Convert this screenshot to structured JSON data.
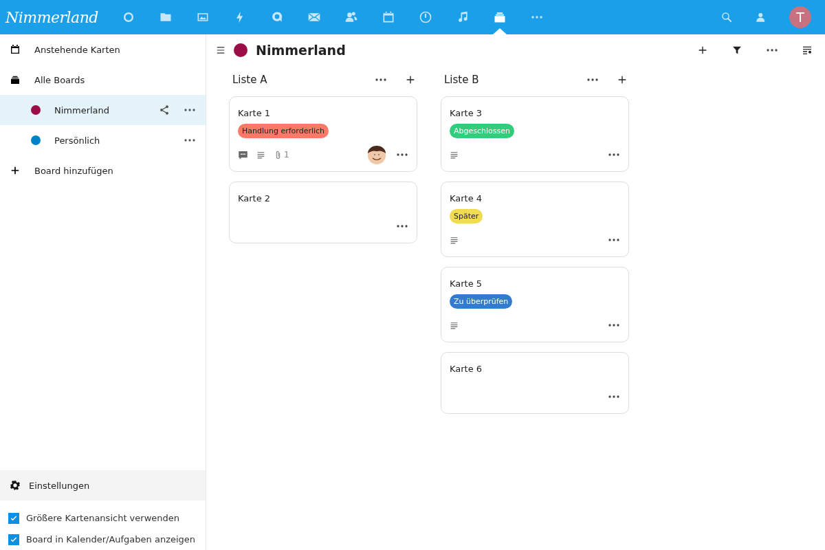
{
  "header": {
    "logo": "Nimmerland",
    "apps": [
      {
        "kind": "dashboard",
        "selected": false
      },
      {
        "kind": "files",
        "selected": false
      },
      {
        "kind": "photos",
        "selected": false
      },
      {
        "kind": "activity",
        "selected": false
      },
      {
        "kind": "talk",
        "selected": false
      },
      {
        "kind": "mail",
        "selected": false
      },
      {
        "kind": "contacts",
        "selected": false
      },
      {
        "kind": "calendar",
        "selected": false
      },
      {
        "kind": "tasks",
        "selected": false
      },
      {
        "kind": "music",
        "selected": false
      },
      {
        "kind": "deck",
        "selected": true
      },
      {
        "kind": "more",
        "selected": false
      }
    ],
    "avatar": "T"
  },
  "sidebar": {
    "nav": [
      {
        "kind": "upcoming",
        "label": "Anstehende Karten"
      },
      {
        "kind": "boards",
        "label": "Alle Boards"
      }
    ],
    "boards": [
      {
        "name": "Nimmerland",
        "color": "#9b0d47",
        "selected": true,
        "shared": true
      },
      {
        "name": "Persönlich",
        "color": "#0082c9",
        "selected": false,
        "shared": false
      }
    ],
    "add_board": "Board hinzufügen",
    "settings": "Einstellungen",
    "options": [
      {
        "label": "Größere Kartenansicht verwenden",
        "checked": true
      },
      {
        "label": "Board in Kalender/Aufgaben anzeigen",
        "checked": true
      }
    ]
  },
  "board": {
    "title": "Nimmerland",
    "color": "#9b0d47",
    "lists": [
      {
        "title": "Liste A",
        "cards": [
          {
            "title": "Karte 1",
            "label": {
              "text": "Handlung erforderlich",
              "color": "#fc7867"
            },
            "comments": true,
            "description": true,
            "attachments": "1",
            "assigned": true
          },
          {
            "title": "Karte 2",
            "comments": false,
            "description": false,
            "assigned": false
          }
        ]
      },
      {
        "title": "Liste B",
        "cards": [
          {
            "title": "Karte 3",
            "label": {
              "text": "Abgeschlossen",
              "color": "#31cc7c"
            },
            "comments": false,
            "description": true,
            "assigned": false
          },
          {
            "title": "Karte 4",
            "label": {
              "text": "Später",
              "color": "#f1db50"
            },
            "comments": false,
            "description": true,
            "assigned": false
          },
          {
            "title": "Karte 5",
            "label": {
              "text": "Zu überprüfen",
              "color": "#317cce"
            },
            "comments": false,
            "description": true,
            "assigned": false
          },
          {
            "title": "Karte 6",
            "comments": false,
            "description": false,
            "assigned": false
          }
        ]
      }
    ]
  }
}
